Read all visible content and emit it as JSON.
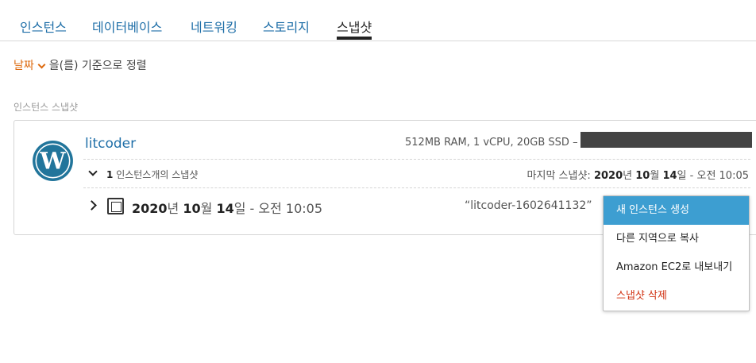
{
  "tabs": {
    "instances": "인스턴스",
    "databases": "데이터베이스",
    "networking": "네트워킹",
    "storage": "스토리지",
    "snapshots": "스냅샷"
  },
  "sort": {
    "key": "날짜",
    "suffix": "을(를) 기준으로 정렬"
  },
  "section_label": "인스턴스 스냅샷",
  "instance": {
    "name": "litcoder",
    "spec": "512MB RAM, 1 vCPU, 20GB SSD –",
    "icon": "wordpress-logo",
    "snapshot_count": "1",
    "snapshot_count_suffix": "인스턴스개의 스냅샷",
    "last_snapshot_label": "마지막 스냅샷:",
    "last_snapshot_year": "2020",
    "last_snapshot_year_unit": "년",
    "last_snapshot_month": "10",
    "last_snapshot_month_unit": "월",
    "last_snapshot_day": "14",
    "last_snapshot_day_unit": "일",
    "last_snapshot_time": "- 오전 10:05"
  },
  "snapshot": {
    "year": "2020",
    "year_unit": "년",
    "month": "10",
    "month_unit": "월",
    "day": "14",
    "day_unit": "일",
    "time": "- 오전 10:05",
    "name": "“litcoder-1602641132”"
  },
  "context_menu": {
    "create_instance": "새 인스턴스 생성",
    "copy_region": "다른 지역으로 복사",
    "export_ec2": "Amazon EC2로 내보내기",
    "delete_snapshot": "스냅샷 삭제"
  },
  "colors": {
    "link": "#1f6fa8",
    "accent": "#dd6b10",
    "highlight": "#3d9ed1",
    "danger": "#d13212"
  }
}
